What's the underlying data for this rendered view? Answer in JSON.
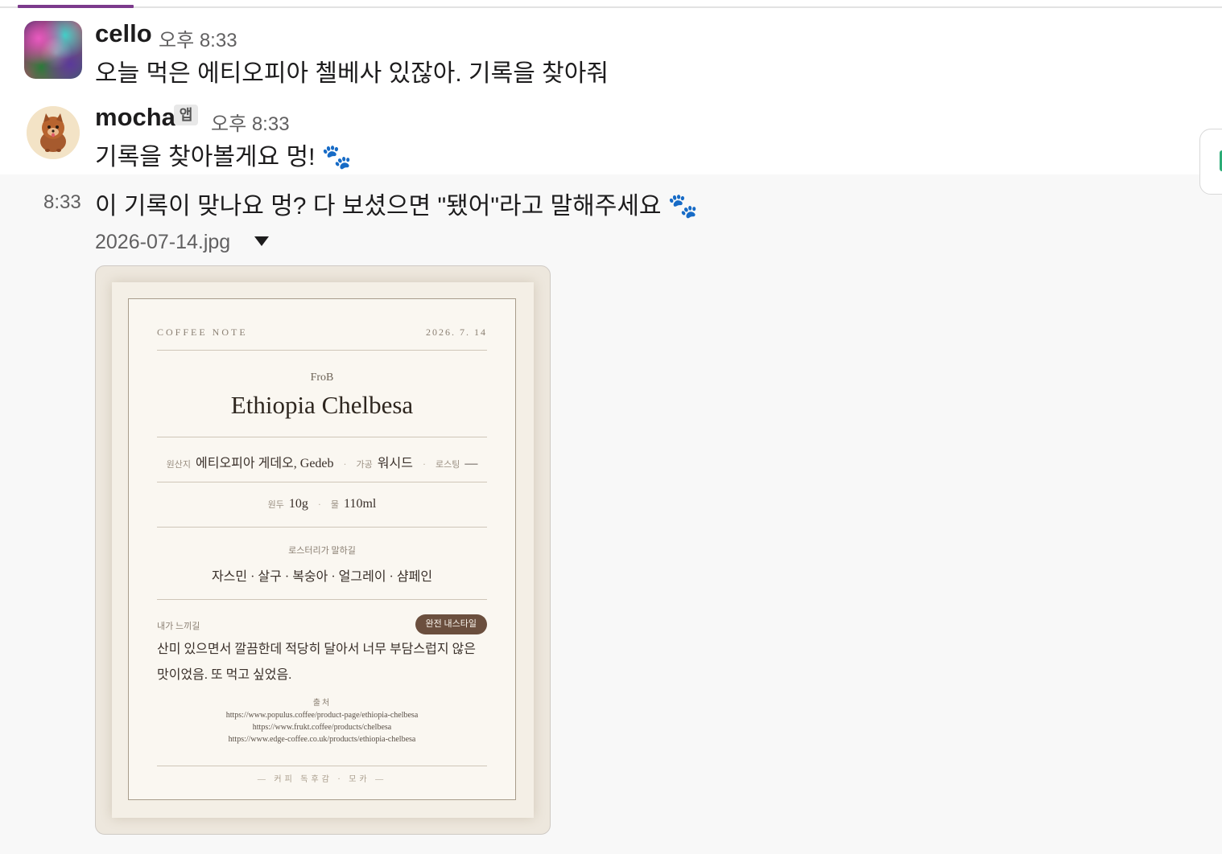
{
  "messages": [
    {
      "sender": "cello",
      "time": "오후 8:33",
      "text": "오늘 먹은 에티오피아 첼베사 있잖아. 기록을 찾아줘"
    },
    {
      "sender": "mocha",
      "badge": "앱",
      "time": "오후 8:33",
      "text": "기록을 찾아볼게요 멍! 🐾"
    },
    {
      "side_time": "8:33",
      "text": "이 기록이 맞나요 멍? 다 보셨으면 \"됐어\"라고 말해주세요 🐾"
    }
  ],
  "attachment": {
    "file_name": "2026-07-14.jpg",
    "card": {
      "label": "COFFEE NOTE",
      "date": "2026. 7. 14",
      "roaster": "FroB",
      "title": "Ethiopia Chelbesa",
      "origin_key": "원산지",
      "origin_value": "에티오피아 게데오, Gedeb",
      "process_key": "가공",
      "process_value": "워시드",
      "roast_key": "로스팅",
      "roast_value": "—",
      "beans_key": "원두",
      "beans_value": "10g",
      "water_key": "물",
      "water_value": "110ml",
      "roastery_caption": "로스터리가 말하길",
      "flavors": "자스민 · 살구 · 복숭아 · 얼그레이 · 샴페인",
      "my_feel_caption": "내가 느끼길",
      "badge": "완전 내스타일",
      "review": "산미 있으면서 깔끔한데 적당히 달아서 너무 부담스럽지 않은 맛이었음. 또 먹고 싶었음.",
      "sources_caption": "출처",
      "sources": [
        "https://www.populus.coffee/product-page/ethiopia-chelbesa",
        "https://www.frukt.coffee/products/chelbesa",
        "https://www.edge-coffee.co.uk/products/ethiopia-chelbesa"
      ],
      "footer": "— 커피 독후감 · 모카 —"
    }
  },
  "colors": {
    "accent": "#7c3a8c",
    "card_badge": "#6b4f3e",
    "card_background": "#faf7f1"
  }
}
